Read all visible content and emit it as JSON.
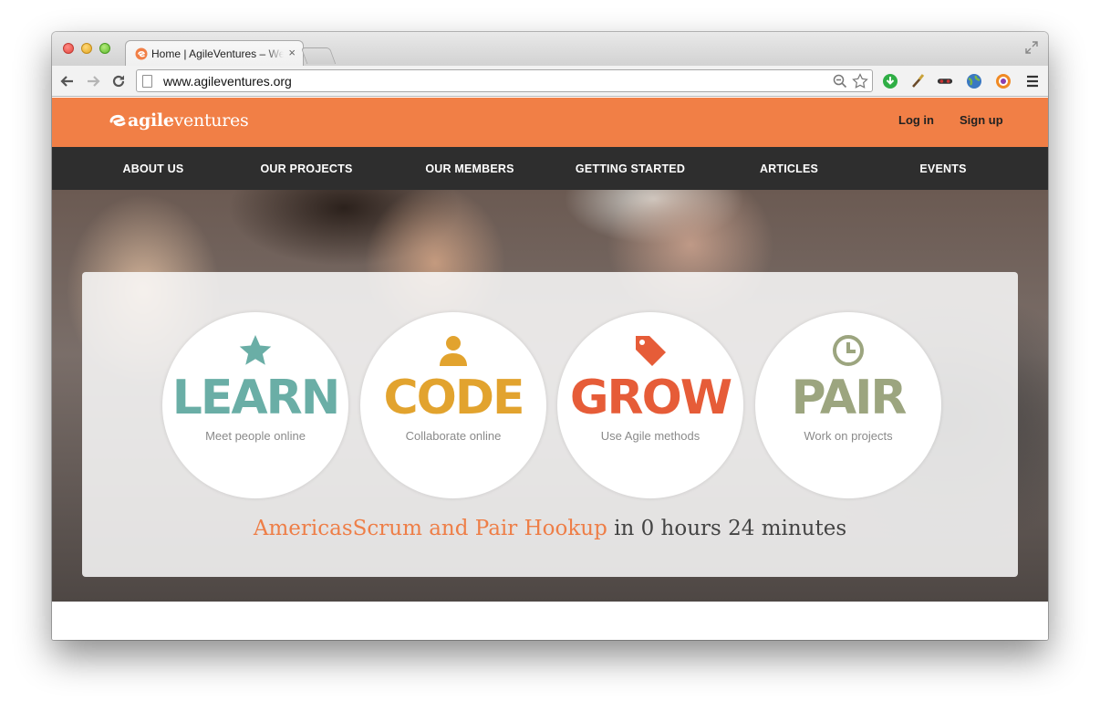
{
  "browser": {
    "tab_title": "Home | AgileVentures – We",
    "tab_close": "×",
    "url": "www.agileventures.org"
  },
  "site": {
    "logo_bold": "agile",
    "logo_light": "ventures",
    "auth": {
      "login": "Log in",
      "signup": "Sign up"
    },
    "nav": [
      "ABOUT US",
      "OUR PROJECTS",
      "OUR MEMBERS",
      "GETTING STARTED",
      "ARTICLES",
      "EVENTS"
    ]
  },
  "hero": {
    "pillars": [
      {
        "word": "LEARN",
        "subtitle": "Meet people online",
        "icon": "star-icon",
        "color": "#6aaea6"
      },
      {
        "word": "CODE",
        "subtitle": "Collaborate online",
        "icon": "person-icon",
        "color": "#e2a32e"
      },
      {
        "word": "GROW",
        "subtitle": "Use Agile methods",
        "icon": "tag-icon",
        "color": "#e65c38"
      },
      {
        "word": "PAIR",
        "subtitle": "Work on projects",
        "icon": "clock-icon",
        "color": "#9ca57f"
      }
    ],
    "event": {
      "name": "AmericasScrum and Pair Hookup",
      "countdown": "in 0 hours 24 minutes"
    }
  },
  "colors": {
    "brand_orange": "#f17f46",
    "nav_dark": "#2e2e2e"
  }
}
